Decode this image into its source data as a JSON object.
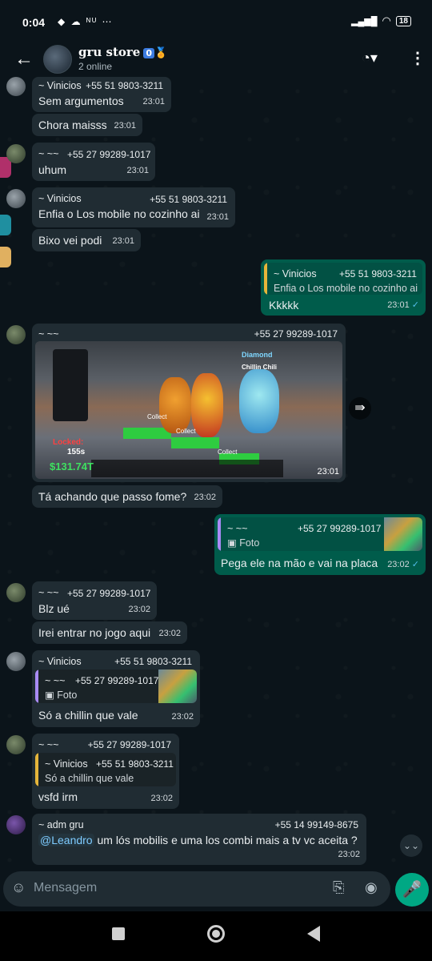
{
  "status_bar": {
    "time": "0:04",
    "left_icons": "◆ ☁ ᴺᵁ ⋯",
    "battery": "18",
    "signal": "▂▄▆█",
    "wifi": "◠"
  },
  "header": {
    "title": "gru store",
    "badge": "0",
    "medal": "🏅",
    "subtitle": "2 online",
    "back_icon": "←",
    "call_icon": "◔▾",
    "menu_icon": "⋮"
  },
  "messages": [
    {
      "sender": "~ Vinicios",
      "phone": "+55 51 9803-3211",
      "text": "Sem argumentos",
      "time": "23:01"
    },
    {
      "text": "Chora maisss",
      "time": "23:01"
    },
    {
      "sender": "~ ~~",
      "phone": "+55 27 99289-1017",
      "text": "uhum",
      "time": "23:01"
    },
    {
      "sender": "~ Vinicios",
      "phone": "+55 51 9803-3211",
      "text": "Enfia o Los mobile no cozinho ai",
      "time": "23:01"
    },
    {
      "text": "Bixo vei podi",
      "time": "23:01"
    },
    {
      "quote_name": "~ Vinicios",
      "quote_phone": "+55 51 9803-3211",
      "quote_text": "Enfia o Los mobile no cozinho ai",
      "text": "Kkkkk",
      "time": "23:01",
      "tick": "✓"
    },
    {
      "sender": "~ ~~",
      "phone": "+55 27 99289-1017",
      "time": "23:01",
      "game": {
        "money": "$131.74T",
        "locked": "Locked:",
        "locked_time": "155s",
        "diamond": "Diamond",
        "chillin": "Chillin Chili",
        "collect": "Collect"
      }
    },
    {
      "text": "Tá achando que passo fome?",
      "time": "23:02"
    },
    {
      "quote_name": "~ ~~",
      "quote_phone": "+55 27 99289-1017",
      "quote_text": "▣ Foto",
      "text": "Pega ele na mão e vai na placa",
      "time": "23:02",
      "tick": "✓"
    },
    {
      "sender": "~ ~~",
      "phone": "+55 27 99289-1017",
      "text": "Blz ué",
      "time": "23:02"
    },
    {
      "text": "Irei entrar no jogo aqui",
      "time": "23:02"
    },
    {
      "sender": "~ Vinicios",
      "phone": "+55 51 9803-3211",
      "quote_name": "~ ~~",
      "quote_phone": "+55 27 99289-1017",
      "quote_text": "▣ Foto",
      "text": "Só a chillin que vale",
      "time": "23:02"
    },
    {
      "sender": "~ ~~",
      "phone": "+55 27 99289-1017",
      "quote_name": "~ Vinicios",
      "quote_phone": "+55 51 9803-3211",
      "quote_text": "Só a chillin que vale",
      "text": "vsfd irm",
      "time": "23:02"
    },
    {
      "sender": "~ adm gru",
      "phone": "+55 14 99149-8675",
      "mention": "@Leandro",
      "text": " um lós mobilis e uma los combi mais a tv vc aceita ?",
      "time": "23:02"
    }
  ],
  "input": {
    "placeholder": "Mensagem",
    "emoji_icon": "☺",
    "clip_icon": "⎘",
    "camera_icon": "◉",
    "mic_icon": "🎤"
  },
  "forward_icon": "⇛",
  "scroll_icon": "⌄⌄"
}
